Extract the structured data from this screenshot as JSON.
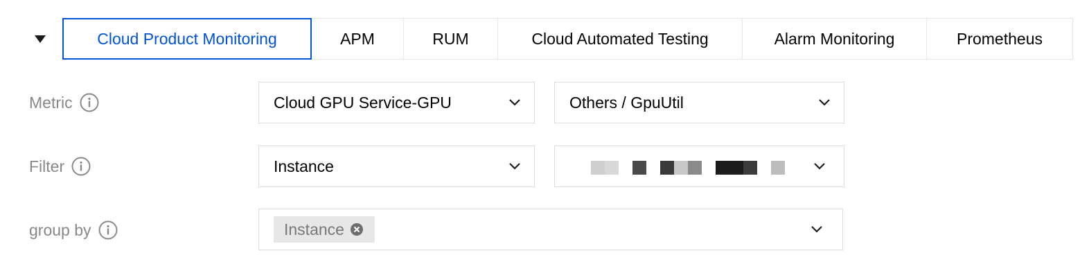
{
  "tabs": [
    {
      "label": "Cloud Product Monitoring",
      "active": true
    },
    {
      "label": "APM",
      "active": false
    },
    {
      "label": "RUM",
      "active": false
    },
    {
      "label": "Cloud Automated Testing",
      "active": false
    },
    {
      "label": "Alarm Monitoring",
      "active": false
    },
    {
      "label": "Prometheus",
      "active": false
    }
  ],
  "metric": {
    "label": "Metric",
    "product_select": "Cloud GPU Service-GPU",
    "metric_select": "Others / GpuUtil"
  },
  "filter": {
    "label": "Filter",
    "dimension_select": "Instance",
    "value_select": ""
  },
  "group_by": {
    "label": "group by",
    "tags": [
      "Instance"
    ]
  },
  "colors": {
    "accent": "#0052d9",
    "border": "#dcdcdc",
    "label": "#888888",
    "tag_bg": "#e7e7e7"
  },
  "icons": {
    "collapse": "caret-down-icon",
    "info": "info-circle-icon",
    "dropdown": "chevron-down-icon",
    "tag_remove": "close-circle-icon"
  }
}
